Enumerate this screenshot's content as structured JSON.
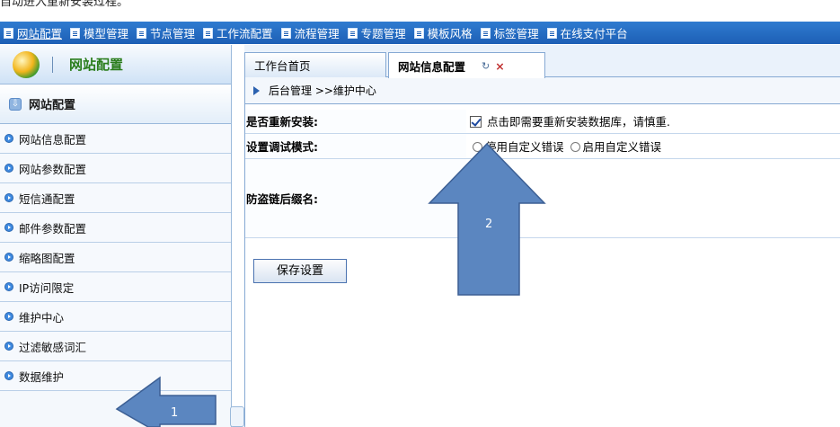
{
  "caption": "自动进入重新安装过程。",
  "nav": [
    {
      "label": "网站配置"
    },
    {
      "label": "模型管理"
    },
    {
      "label": "节点管理"
    },
    {
      "label": "工作流配置"
    },
    {
      "label": "流程管理"
    },
    {
      "label": "专题管理"
    },
    {
      "label": "模板风格"
    },
    {
      "label": "标签管理"
    },
    {
      "label": "在线支付平台"
    }
  ],
  "sidebar": {
    "header_title": "网站配置",
    "section_label": "网站配置",
    "items": [
      {
        "label": "网站信息配置"
      },
      {
        "label": "网站参数配置"
      },
      {
        "label": "短信通配置"
      },
      {
        "label": "邮件参数配置"
      },
      {
        "label": "缩略图配置"
      },
      {
        "label": "IP访问限定"
      },
      {
        "label": "维护中心"
      },
      {
        "label": "过滤敏感词汇"
      },
      {
        "label": "数据维护"
      }
    ]
  },
  "tabs": {
    "home": "工作台首页",
    "active": "网站信息配置",
    "active_extra": "↻",
    "close": "×"
  },
  "breadcrumb": "后台管理 >>维护中心",
  "form": {
    "reinstall_label": "是否重新安装:",
    "reinstall_text": "点击即需要重新安装数据库，请慎重.",
    "debug_label": "设置调试模式:",
    "debug_option1": "停用自定义错误",
    "debug_option2": "启用自定义错误",
    "hotlink_label": "防盗链后缀名:",
    "hotlink_value": ""
  },
  "save_button": "保存设置",
  "annotations": {
    "arrow1_label": "1",
    "arrow2_label": "2",
    "arrow_color": "#5b86c0"
  }
}
